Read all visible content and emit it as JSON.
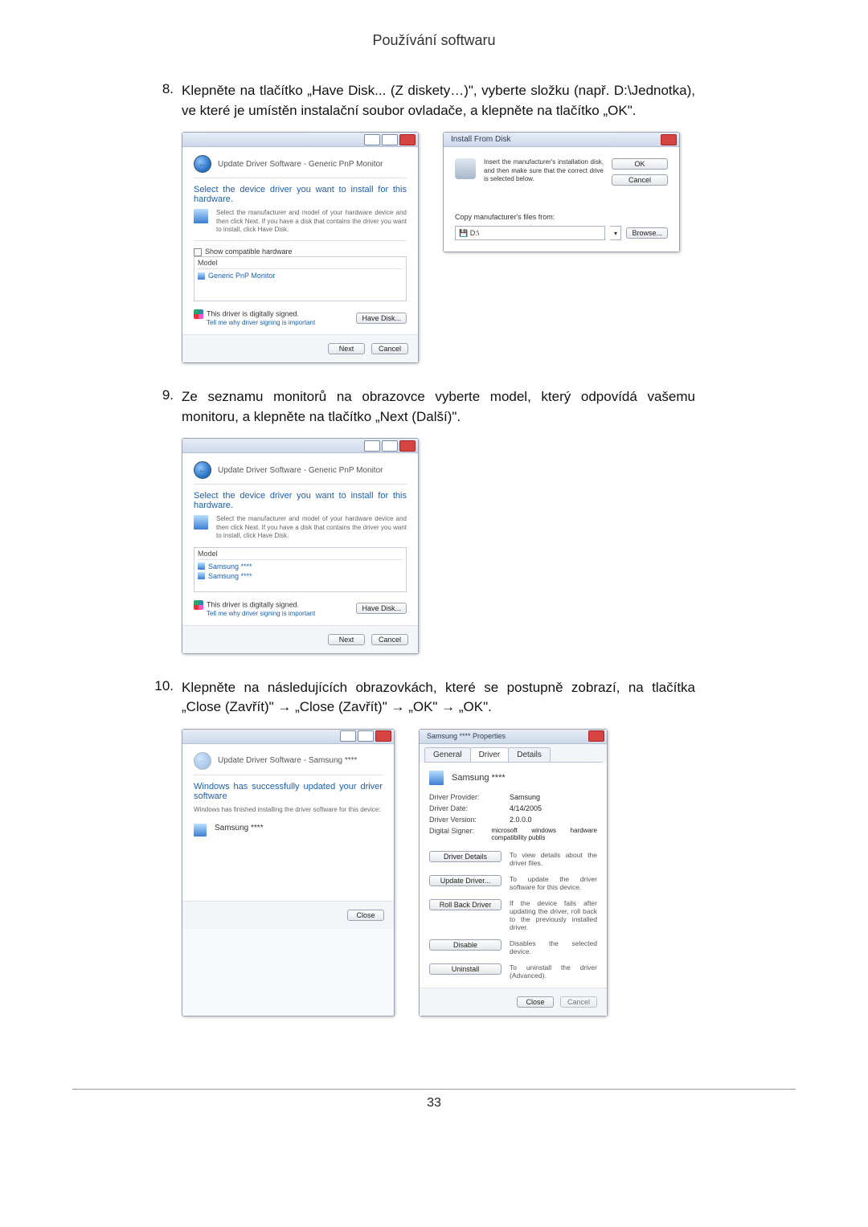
{
  "header": {
    "title": "Používání softwaru"
  },
  "steps": {
    "s8": {
      "num": "8.",
      "text": "Klepněte na tlačítko „Have Disk... (Z diskety…)\", vyberte složku (např. D:\\Jednotka), ve které je umístěn instalační soubor ovladače, a klepněte na tlačítko „OK\"."
    },
    "s9": {
      "num": "9.",
      "text": "Ze seznamu monitorů na obrazovce vyberte model, který odpovídá vašemu monitoru, a klepněte na tlačítko „Next (Další)\"."
    },
    "s10": {
      "num": "10.",
      "text": "Klepněte na následujících obrazovkách, které se postupně zobrazí, na tlačítka „Close (Zavřít)\" → „Close (Zavřít)\" → „OK\" → „OK\"."
    }
  },
  "dlg1": {
    "path": "Update Driver Software - Generic PnP Monitor",
    "section": "Select the device driver you want to install for this hardware.",
    "help": "Select the manufacturer and model of your hardware device and then click Next. If you have a disk that contains the driver you want to install, click Have Disk.",
    "show_compat": "Show compatible hardware",
    "model_hdr": "Model",
    "model_item": "Generic PnP Monitor",
    "signed": "This driver is digitally signed.",
    "tell": "Tell me why driver signing is important",
    "have_disk": "Have Disk...",
    "next": "Next",
    "cancel": "Cancel"
  },
  "dlg2": {
    "title": "Install From Disk",
    "msg": "Insert the manufacturer's installation disk, and then make sure that the correct drive is selected below.",
    "ok": "OK",
    "cancel": "Cancel",
    "copy_label": "Copy manufacturer's files from:",
    "path_value": "D:\\",
    "browse": "Browse..."
  },
  "dlg3": {
    "path": "Update Driver Software - Generic PnP Monitor",
    "section": "Select the device driver you want to install for this hardware.",
    "help": "Select the manufacturer and model of your hardware device and then click Next. If you have a disk that contains the driver you want to install, click Have Disk.",
    "model_hdr": "Model",
    "item1": "Samsung ****",
    "item2": "Samsung ****",
    "signed": "This driver is digitally signed.",
    "tell": "Tell me why driver signing is important",
    "have_disk": "Have Disk...",
    "next": "Next",
    "cancel": "Cancel"
  },
  "dlg4": {
    "path": "Update Driver Software - Samsung ****",
    "section": "Windows has successfully updated your driver software",
    "done": "Windows has finished installing the driver software for this device:",
    "item": "Samsung ****",
    "close": "Close"
  },
  "dlg5": {
    "title": "Samsung **** Properties",
    "tab_general": "General",
    "tab_driver": "Driver",
    "tab_details": "Details",
    "dev_name": "Samsung ****",
    "rows": {
      "provider_k": "Driver Provider:",
      "provider_v": "Samsung",
      "date_k": "Driver Date:",
      "date_v": "4/14/2005",
      "version_k": "Driver Version:",
      "version_v": "2.0.0.0",
      "signer_k": "Digital Signer:",
      "signer_v": "microsoft windows hardware compatibility publis"
    },
    "btns": {
      "details": "Driver Details",
      "details_d": "To view details about the driver files.",
      "update": "Update Driver...",
      "update_d": "To update the driver software for this device.",
      "rollback": "Roll Back Driver",
      "rollback_d": "If the device fails after updating the driver, roll back to the previously installed driver.",
      "disable": "Disable",
      "disable_d": "Disables the selected device.",
      "uninstall": "Uninstall",
      "uninstall_d": "To uninstall the driver (Advanced)."
    },
    "close": "Close",
    "cancel": "Cancel"
  },
  "footer": {
    "page": "33"
  }
}
